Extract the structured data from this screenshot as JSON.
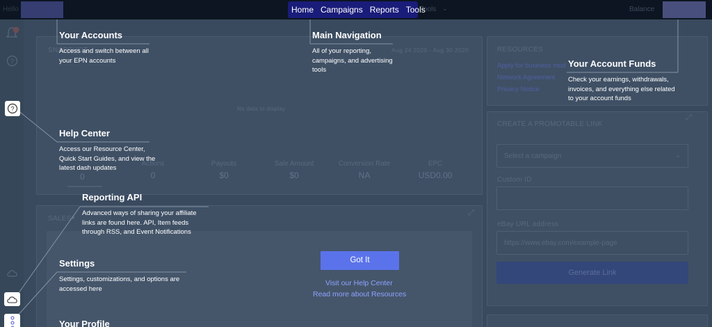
{
  "topbar": {
    "left_text": "Hello",
    "balance_label": "Balance",
    "ghost_tools": "Tools"
  },
  "nav": {
    "items": [
      {
        "label": "Home"
      },
      {
        "label": "Campaigns"
      },
      {
        "label": "Reports"
      },
      {
        "label": "Tools"
      }
    ]
  },
  "dashboard": {
    "snapshot": {
      "title": "SNAPSHOT",
      "date_range": "Aug 24 2020 - Aug 30 2020",
      "empty": "No data to display",
      "stats": [
        {
          "label": "Actions",
          "value": "0"
        },
        {
          "label": "Payouts",
          "value": "$0"
        },
        {
          "label": "Sale Amount",
          "value": "$0"
        },
        {
          "label": "Conversion Rate",
          "value": "NA"
        },
        {
          "label": "EPC",
          "value": "USD0.00"
        }
      ],
      "first_value": "0"
    },
    "sales": {
      "title": "SALES"
    },
    "resources": {
      "title": "RESOURCES",
      "links": [
        "Apply for business mod",
        "Network Agreement",
        "Privacy Notice"
      ]
    },
    "promo": {
      "title": "CREATE A PROMOTABLE LINK",
      "select_placeholder": "Select a campaign",
      "custom_id_label": "Custom ID",
      "url_label": "eBay URL address",
      "url_placeholder": "https://www.ebay.com/example-page",
      "generate": "Generate Link"
    }
  },
  "tips": {
    "accounts": {
      "title": "Your Accounts",
      "desc": "Access and switch between all your EPN accounts"
    },
    "navigation": {
      "title": "Main Navigation",
      "desc": "All of your reporting, campaigns, and advertising tools"
    },
    "funds": {
      "title": "Your Account Funds",
      "desc": "Check your earnings, withdrawals, invoices, and everything else related to your account funds"
    },
    "help": {
      "title": "Help Center",
      "desc": "Access our Resource Center, Quick Start Guides, and view the latest dash updates"
    },
    "api": {
      "title": "Reporting API",
      "desc": "Advanced ways of sharing your affiliate links are found here. API, Item feeds through RSS, and Event Notifications"
    },
    "settings": {
      "title": "Settings",
      "desc": "Settings, customizations, and options are accessed here"
    },
    "profile": {
      "title": "Your Profile"
    }
  },
  "actions": {
    "got_it": "Got It",
    "help_link": "Visit our Help Center",
    "resources_link": "Read more about Resources"
  },
  "colors": {
    "accent": "#5b73ea",
    "nav_highlight": "#1a1c7a",
    "link": "#8ea2ff"
  }
}
